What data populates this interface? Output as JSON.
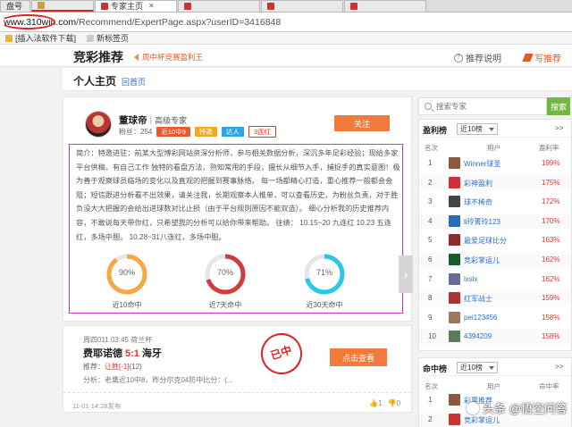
{
  "browser": {
    "tabs": [
      {
        "label": "盘号",
        "active": false
      },
      {
        "label": "",
        "active": false
      },
      {
        "label": "专家主页",
        "active": true
      },
      {
        "label": "",
        "active": false
      },
      {
        "label": "",
        "active": false
      },
      {
        "label": "",
        "active": false
      }
    ],
    "url_host": "www.310win.com",
    "url_path": "/Recommend/ExpertPage.aspx?userID=3416848",
    "bookmarks": [
      "[插入法软件下载]",
      "新标签页"
    ]
  },
  "header": {
    "logo": "竞彩推荐",
    "notice": "周中杯竞赛盈利王",
    "help": "推荐说明",
    "write": "写推荐"
  },
  "subheader": {
    "title": "个人主页",
    "back": "回首页"
  },
  "profile": {
    "name": "董球帝",
    "level": "高级专家",
    "fans": "粉丝：254",
    "badges": [
      "近10中9",
      "特邀",
      "达人",
      "3连红"
    ],
    "follow": "关注",
    "intro": "简介：特邀进驻：前某大型博彩网站资深分析师，参与相关数据分析，深沉多年足彩经验；现给多家平台供稿，有自己工作 独特的看盘方法，熟知常用的手段，擅长从细节入手，捕捉手的真实意图！极为善于观察球员临场的变化以及直观的把握到赛事脉络。 每一场都精心打造，重心推荐一般都会会阻；短信跟进分析看不出效果，请关注我，长期观察本人推单，可以查看历史，为粉丝负责，对于胜负没大大把握的会给出进球数对比止损（由于平台规则原因不能双选）。 细心分析我的历史推荐内容，不敢说每天带你红，只希望我的分析可以给你带来帮助。 往绩： 10.15~20 九连红 10.23 五连红，多场中胆。 10.28~31八连红，多场中胆。",
    "stats": [
      {
        "value": 90,
        "text": "90%",
        "label": "近10命中",
        "color": "#f5a843"
      },
      {
        "value": 70,
        "text": "70%",
        "label": "近7天命中",
        "color": "#d13c3c"
      },
      {
        "value": 71,
        "text": "71%",
        "label": "近30天命中",
        "color": "#2cc6e8"
      }
    ]
  },
  "match": {
    "meta": "周四011 03:45 荷兰杯",
    "home": "费耶诺德",
    "score": "5:1",
    "away": "海牙",
    "rec_prefix": "推荐：",
    "pick": "让胜[-1]",
    "pick_odds": "(12)",
    "analysis": "分析：老鹰近10中8，昨分尔克04防中比分：(...",
    "stamp": "已中",
    "view_btn": "点击查看",
    "time": "11-01 14:28发布",
    "likes": "1",
    "dislikes": "0"
  },
  "sidebar": {
    "search_placeholder": "搜索专家",
    "search_btn": "搜索",
    "profit_title": "盈利榜",
    "profit_select": "近10榜",
    "more": ">>",
    "col_rank": "名次",
    "col_user": "用户",
    "col_rate": "盈利率",
    "ranks": [
      {
        "num": "1",
        "name": "Winner球圣",
        "rate": "199%"
      },
      {
        "num": "2",
        "name": "彩神盈利",
        "rate": "175%"
      },
      {
        "num": "3",
        "name": "球不稀奇",
        "rate": "172%"
      },
      {
        "num": "4",
        "name": "li玲菁玲123",
        "rate": "170%"
      },
      {
        "num": "5",
        "name": "最爱足球比分",
        "rate": "163%"
      },
      {
        "num": "6",
        "name": "竞彩掌运儿",
        "rate": "162%"
      },
      {
        "num": "7",
        "name": "lxslx",
        "rate": "162%"
      },
      {
        "num": "8",
        "name": "红军战士",
        "rate": "159%"
      },
      {
        "num": "9",
        "name": "pei123456",
        "rate": "158%"
      },
      {
        "num": "10",
        "name": "4394209",
        "rate": "158%"
      }
    ],
    "hit_title": "命中榜",
    "hit_select": "近10榜",
    "col_hit": "命中率",
    "hit_rows": [
      {
        "num": "1",
        "name": "彩票推荐",
        "rate": ""
      },
      {
        "num": "2",
        "name": "竞彩掌运儿",
        "rate": ""
      }
    ]
  },
  "watermark": "头条 @悟空问答",
  "colors": {
    "accent": "#f17a3d",
    "link": "#2f6fc1",
    "highlight": "#c838c8"
  }
}
